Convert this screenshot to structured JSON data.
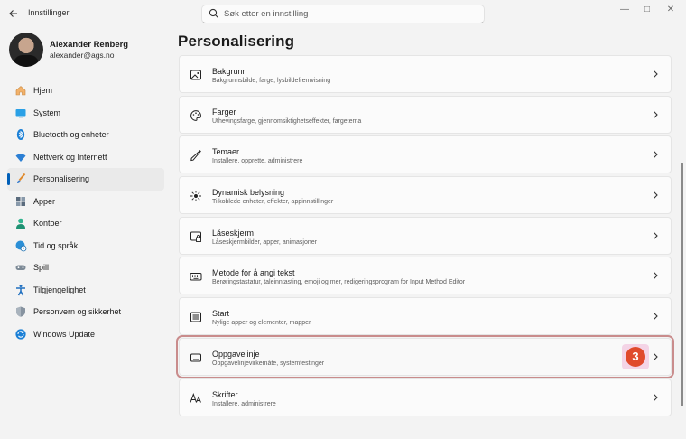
{
  "window": {
    "title": "Innstillinger",
    "controls": [
      "—",
      "□",
      "✕"
    ]
  },
  "search": {
    "placeholder": "Søk etter en innstilling"
  },
  "profile": {
    "name": "Alexander Renberg",
    "email": "alexander@ags.no"
  },
  "sidebar": {
    "items": [
      {
        "label": "Hjem",
        "icon": "home-icon",
        "active": false
      },
      {
        "label": "System",
        "icon": "display-icon",
        "active": false
      },
      {
        "label": "Bluetooth og enheter",
        "icon": "bluetooth-icon",
        "active": false
      },
      {
        "label": "Nettverk og Internett",
        "icon": "wifi-icon",
        "active": false
      },
      {
        "label": "Personalisering",
        "icon": "brush-icon",
        "active": true
      },
      {
        "label": "Apper",
        "icon": "apps-icon",
        "active": false
      },
      {
        "label": "Kontoer",
        "icon": "person-icon",
        "active": false
      },
      {
        "label": "Tid og språk",
        "icon": "globe-clock-icon",
        "active": false
      },
      {
        "label": "Spill",
        "icon": "gamepad-icon",
        "active": false
      },
      {
        "label": "Tilgjengelighet",
        "icon": "accessibility-icon",
        "active": false
      },
      {
        "label": "Personvern og sikkerhet",
        "icon": "shield-icon",
        "active": false
      },
      {
        "label": "Windows Update",
        "icon": "update-icon",
        "active": false
      }
    ]
  },
  "main": {
    "title": "Personalisering",
    "cards": [
      {
        "title": "Bakgrunn",
        "subtitle": "Bakgrunnsbilde, farge, lysbildefremvisning",
        "icon": "image-icon"
      },
      {
        "title": "Farger",
        "subtitle": "Uthevingsfarge, gjennomsiktighetseffekter, fargetema",
        "icon": "palette-icon"
      },
      {
        "title": "Temaer",
        "subtitle": "Installere, opprette, administrere",
        "icon": "pen-icon"
      },
      {
        "title": "Dynamisk belysning",
        "subtitle": "Tilkoblede enheter, effekter, appinnstillinger",
        "icon": "light-icon"
      },
      {
        "title": "Låseskjerm",
        "subtitle": "Låseskjermbilder, apper, animasjoner",
        "icon": "lock-screen-icon"
      },
      {
        "title": "Metode for å angi tekst",
        "subtitle": "Berøringstastatur, taleinntasting, emoji og mer, redigeringsprogram for Input Method Editor",
        "icon": "keyboard-icon"
      },
      {
        "title": "Start",
        "subtitle": "Nylige apper og elementer, mapper",
        "icon": "start-icon"
      },
      {
        "title": "Oppgavelinje",
        "subtitle": "Oppgavelinjevirkemåte, systemfestinger",
        "icon": "taskbar-icon",
        "highlighted": true,
        "badge": "3"
      },
      {
        "title": "Skrifter",
        "subtitle": "Installere, administrere",
        "icon": "font-icon"
      }
    ]
  },
  "colors": {
    "accent": "#005fb8",
    "highlight_border": "#c98c8c",
    "badge": "#e04a2c"
  }
}
